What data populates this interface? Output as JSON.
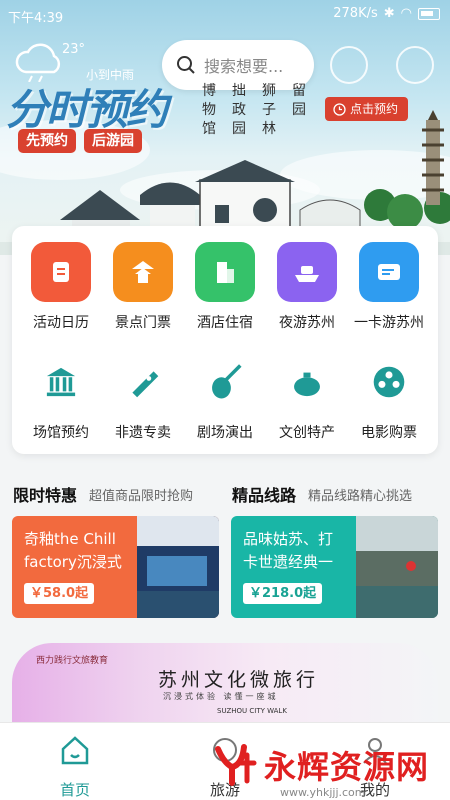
{
  "status_bar": {
    "time": "下午4:39",
    "network_speed": "278K/s"
  },
  "weather": {
    "temperature": "23°",
    "condition": "小到中雨"
  },
  "hero": {
    "slogan": "分时预约",
    "tag_left": "先预约",
    "tag_right": "后游园",
    "gardens": [
      [
        "博",
        "物",
        "馆"
      ],
      [
        "拙",
        "政",
        "园"
      ],
      [
        "狮",
        "子",
        "林"
      ],
      [
        "留",
        "园"
      ]
    ],
    "reserve_button": "点击预约"
  },
  "search": {
    "placeholder": "搜索想要..."
  },
  "grid": [
    {
      "label": "活动日历",
      "icon": "calendar-icon",
      "color": "#f25a3a"
    },
    {
      "label": "景点门票",
      "icon": "pavilion-icon",
      "color": "#f58e1e"
    },
    {
      "label": "酒店住宿",
      "icon": "building-icon",
      "color": "#35c26a"
    },
    {
      "label": "夜游苏州",
      "icon": "boat-icon",
      "color": "#8b63f0"
    },
    {
      "label": "一卡游苏州",
      "icon": "card-icon",
      "color": "#2f9cf0"
    },
    {
      "label": "场馆预约",
      "icon": "museum-icon",
      "color": "#1f9a96"
    },
    {
      "label": "非遗专卖",
      "icon": "fan-icon",
      "color": "#1f9a96"
    },
    {
      "label": "剧场演出",
      "icon": "pipa-icon",
      "color": "#1f9a96"
    },
    {
      "label": "文创特产",
      "icon": "teapot-icon",
      "color": "#1f9a96"
    },
    {
      "label": "电影购票",
      "icon": "film-reel-icon",
      "color": "#1f9a96"
    }
  ],
  "sections": {
    "limited": {
      "title": "限时特惠",
      "subtitle": "超值商品限时抢购"
    },
    "routes": {
      "title": "精品线路",
      "subtitle": "精品线路精心挑选"
    }
  },
  "deals": [
    {
      "text_line1": "奇釉the Chill",
      "text_line2": "factory沉浸式",
      "price": "￥58.0起",
      "color": "#f26a3e",
      "price_color": "#f26a3e"
    },
    {
      "text_line1": "品味姑苏、打",
      "text_line2": "卡世遗经典一",
      "price": "￥218.0起",
      "color": "#19b6a6",
      "price_color": "#19a394"
    }
  ],
  "banner": {
    "logo_text": "西力践行文旅教育",
    "title": "苏州文化微旅行",
    "subtitle": "沉浸式体验 读懂一座城",
    "badge": "SUZHOU CITY WALK"
  },
  "tabbar": [
    {
      "label": "首页",
      "icon": "home-icon",
      "active": true
    },
    {
      "label": "旅游",
      "icon": "travel-icon",
      "active": false
    },
    {
      "label": "我的",
      "icon": "user-icon",
      "active": false
    }
  ],
  "watermark": {
    "text": "永辉资源网",
    "url": "www.yhkjjj.com"
  },
  "colors": {
    "accent": "#1f9a96",
    "red": "#d9412f"
  }
}
